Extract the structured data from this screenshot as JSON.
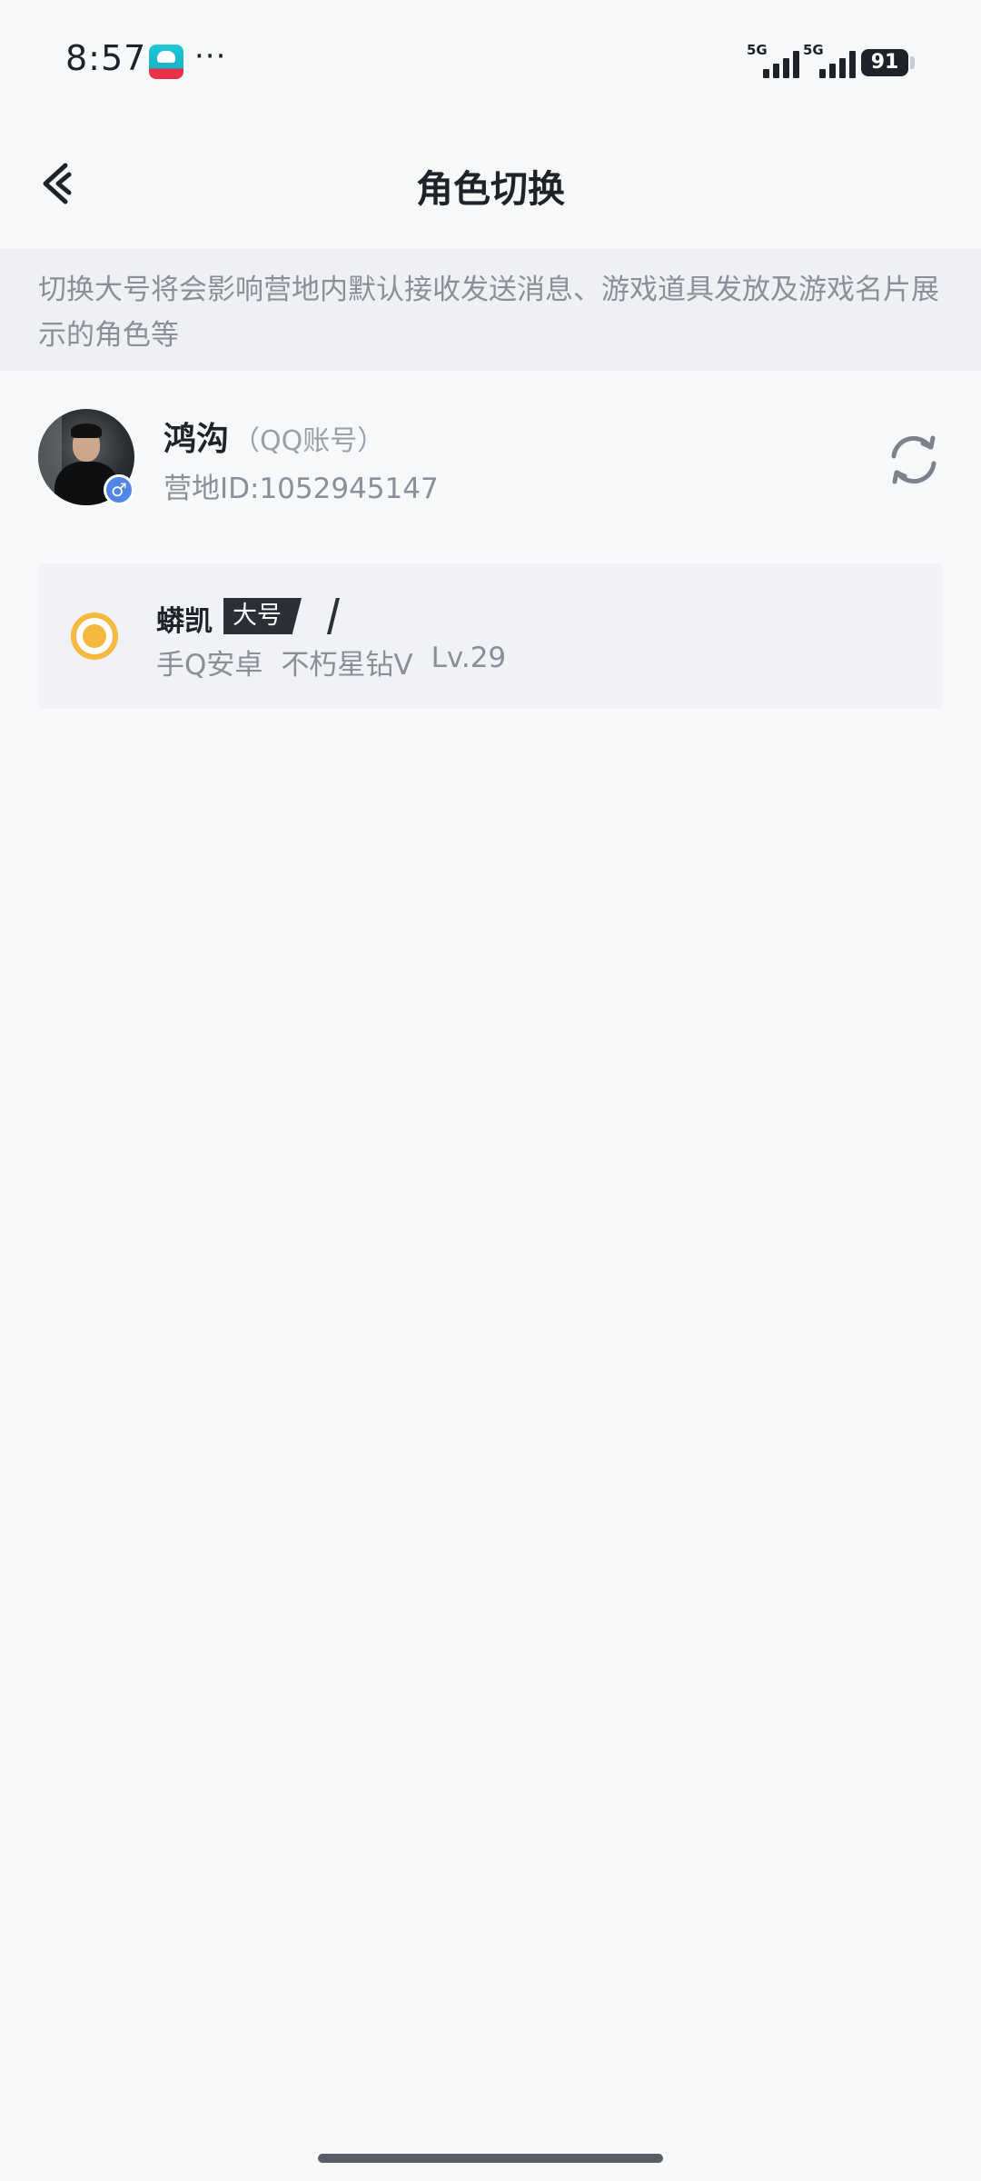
{
  "status_bar": {
    "time": "8:57",
    "app_icon": "camp-app-icon",
    "more": "···",
    "signal_1_label": "5G",
    "signal_2_label": "5G",
    "battery": "91"
  },
  "header": {
    "title": "角色切换",
    "back_icon": "chevron-left-icon"
  },
  "notice": {
    "text": "切换大号将会影响营地内默认接收发送消息、游戏道具发放及游戏名片展示的角色等"
  },
  "account": {
    "nickname": "鸿沟",
    "account_type": "（QQ账号）",
    "camp_id": "营地ID:1052945147",
    "gender_symbol": "♂",
    "refresh_icon": "refresh-icon"
  },
  "roles": [
    {
      "name": "蟒凯",
      "tag": "大号",
      "platform": "手Q安卓",
      "rank": "不朽星钻Ⅴ",
      "level": "Lv.29",
      "selected": true
    }
  ],
  "colors": {
    "accent": "#f5b941",
    "background": "#f7f8fa",
    "notice_bg": "#eef0f3",
    "gender_badge": "#4f86e8"
  }
}
